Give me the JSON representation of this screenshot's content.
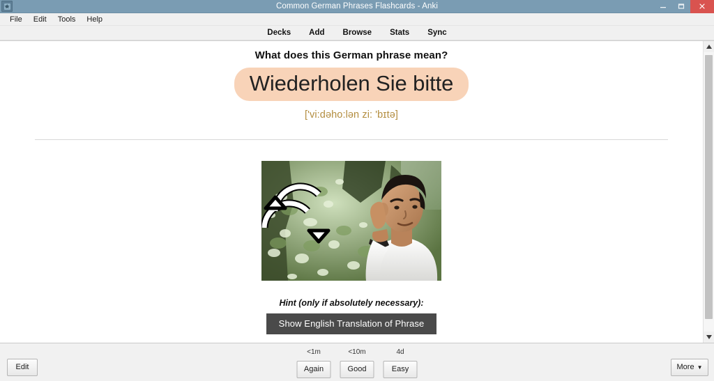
{
  "window": {
    "title": "Common German Phrases Flashcards - Anki",
    "app_icon": "anki-icon",
    "minimize_label": "Minimize",
    "maximize_label": "Maximize",
    "close_label": "Close",
    "titlebar_color": "#7a9cb3",
    "close_color": "#d9534f"
  },
  "menubar": {
    "items": [
      {
        "label": "File"
      },
      {
        "label": "Edit"
      },
      {
        "label": "Tools"
      },
      {
        "label": "Help"
      }
    ]
  },
  "navbar": {
    "items": [
      {
        "label": "Decks"
      },
      {
        "label": "Add"
      },
      {
        "label": "Browse"
      },
      {
        "label": "Stats"
      },
      {
        "label": "Sync"
      }
    ]
  },
  "card": {
    "question_prompt": "What does this German phrase mean?",
    "phrase": "Wiederholen Sie bitte",
    "phrase_bg_color": "#f8d3b8",
    "ipa": "['vi:dəho:lən zi: 'bɪtə]",
    "ipa_color": "#b38d3f",
    "media_alt": "Man cupping his ear to listen, with repeat arrows icon over green foliage background",
    "hint_label": "Hint (only if absolutely necessary):",
    "hint_button": "Show English Translation of Phrase",
    "hint_button_color": "#4a4a4a"
  },
  "bottombar": {
    "edit_label": "Edit",
    "more_label": "More",
    "more_caret": "▼",
    "answers": [
      {
        "time": "<1m",
        "label": "Again"
      },
      {
        "time": "<10m",
        "label": "Good"
      },
      {
        "time": "4d",
        "label": "Easy"
      }
    ]
  },
  "scrollbar": {
    "up_arrow": "▲",
    "down_arrow": "▼"
  }
}
